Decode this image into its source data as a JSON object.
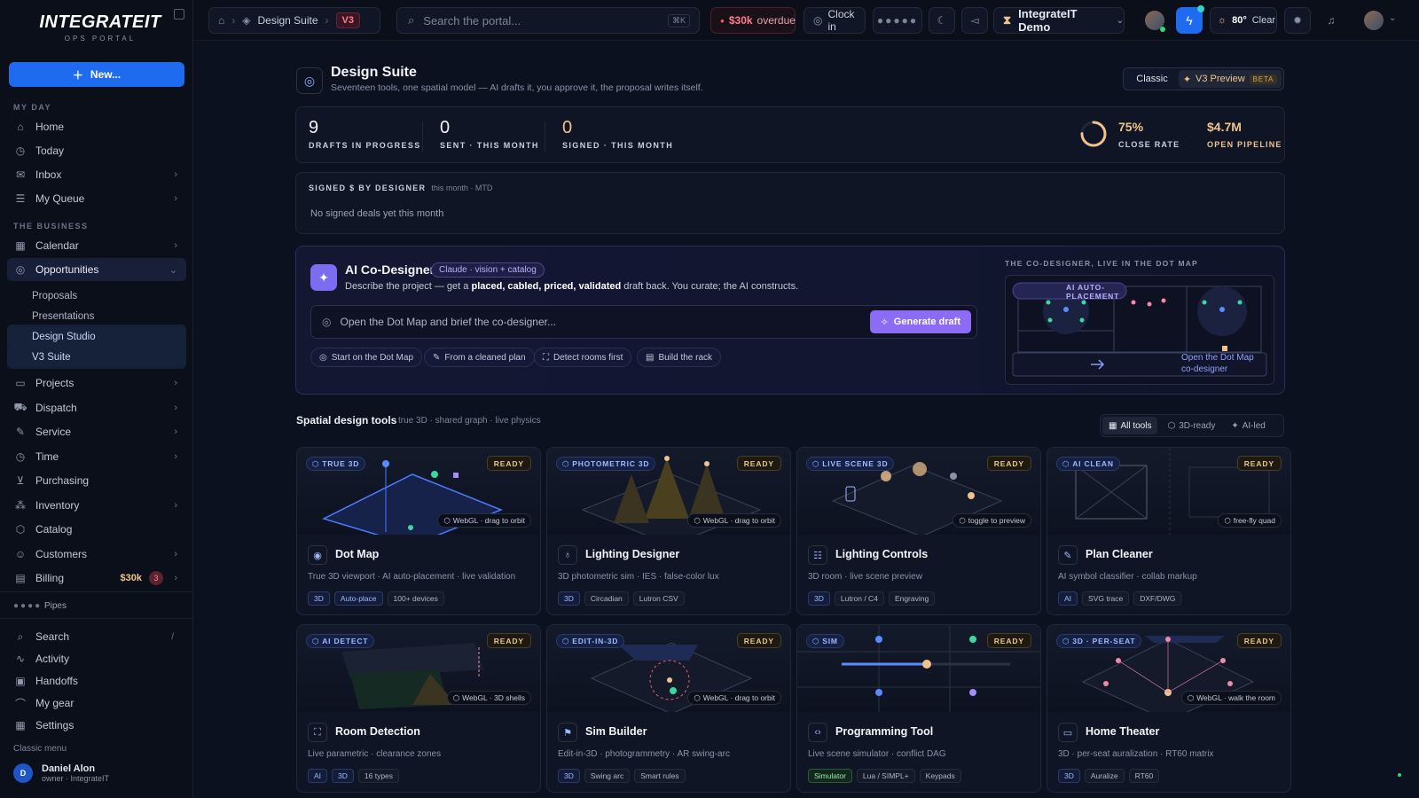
{
  "sidebar": {
    "logo": "INTEGRATEIT",
    "logo_sub": "OPS PORTAL",
    "new_button": "New...",
    "sections": {
      "my_day": "MY DAY",
      "business": "THE BUSINESS"
    },
    "my_day": [
      {
        "label": "Home",
        "icon": "home-icon"
      },
      {
        "label": "Today",
        "icon": "clock-icon"
      },
      {
        "label": "Inbox",
        "icon": "mail-icon",
        "chevron": true
      },
      {
        "label": "My Queue",
        "icon": "list-icon",
        "chevron": true
      }
    ],
    "business": [
      {
        "label": "Calendar",
        "icon": "grid-icon",
        "chevron": true
      },
      {
        "label": "Opportunities",
        "icon": "target-icon",
        "chevron": true,
        "expanded": true
      }
    ],
    "opportunities_sub": [
      "Proposals",
      "Presentations",
      "Design Studio",
      "V3 Suite"
    ],
    "business_more": [
      {
        "label": "Projects",
        "icon": "clipboard-icon",
        "chevron": true
      },
      {
        "label": "Dispatch",
        "icon": "truck-icon",
        "chevron": true
      },
      {
        "label": "Service",
        "icon": "wrench-icon",
        "chevron": true
      },
      {
        "label": "Time",
        "icon": "clock-icon",
        "chevron": true
      },
      {
        "label": "Purchasing",
        "icon": "cart-icon"
      },
      {
        "label": "Inventory",
        "icon": "boxes-icon",
        "chevron": true
      },
      {
        "label": "Catalog",
        "icon": "package-icon"
      },
      {
        "label": "Customers",
        "icon": "users-icon",
        "chevron": true
      },
      {
        "label": "Billing",
        "icon": "receipt-icon",
        "chevron": true,
        "amount": "$30k",
        "count": "3"
      }
    ],
    "pipes": "Pipes",
    "tools": [
      {
        "label": "Search",
        "icon": "search-icon",
        "shortcut": "/"
      },
      {
        "label": "Activity",
        "icon": "activity-icon"
      },
      {
        "label": "Handoffs",
        "icon": "inbox-icon"
      },
      {
        "label": "My gear",
        "icon": "gear-bag-icon"
      },
      {
        "label": "Settings",
        "icon": "grid-icon"
      }
    ],
    "classic_menu": "Classic menu",
    "user": {
      "initial": "D",
      "name": "Daniel Alon",
      "role": "owner · IntegrateIT"
    }
  },
  "topbar": {
    "breadcrumb": "Design Suite",
    "badge": "V3",
    "search_placeholder": "Search the portal...",
    "search_shortcut": "⌘K",
    "overdue_amount": "$30k",
    "overdue_label": "overdue",
    "clock_in": "Clock in",
    "org": "IntegrateIT Demo",
    "temp": "80°",
    "weather": "Clear"
  },
  "page": {
    "title": "Design Suite",
    "subtitle": "Seventeen tools, one spatial model — AI drafts it, you approve it, the proposal writes itself.",
    "toggle_classic": "Classic",
    "toggle_preview": "V3 Preview",
    "toggle_beta": "BETA"
  },
  "stats": [
    {
      "value": "9",
      "label": "DRAFTS IN PROGRESS"
    },
    {
      "value": "0",
      "label": "SENT · THIS MONTH"
    },
    {
      "value": "0",
      "label": "SIGNED · THIS MONTH"
    }
  ],
  "close_rate": {
    "value": "75%",
    "label": "CLOSE RATE",
    "fraction": 0.75
  },
  "pipeline": {
    "value": "$4.7M",
    "label": "OPEN PIPELINE"
  },
  "signed_panel": {
    "title": "SIGNED $ BY DESIGNER",
    "period": "this month · MTD",
    "empty": "No signed deals yet this month"
  },
  "ai": {
    "title": "AI Co-Designer",
    "tag": "Claude · vision + catalog",
    "desc_pre": "Describe the project — get a",
    "desc_bold": "placed, cabled, priced, validated",
    "desc_post": "draft back. You curate; the AI constructs.",
    "brief_placeholder": "Open the Dot Map and brief the co-designer...",
    "generate": "Generate draft",
    "chips": [
      "Start on the Dot Map",
      "From a cleaned plan",
      "Detect rooms first",
      "Build the rack"
    ],
    "map_label": "THE CO-DESIGNER, LIVE IN THE DOT MAP",
    "map_badge": "AI AUTO-PLACEMENT",
    "map_cta": "Open the Dot Map co-designer"
  },
  "tools_section": {
    "title": "Spatial design tools",
    "subtitle": "true 3D · shared graph · live physics",
    "filters": [
      "All tools",
      "3D-ready",
      "AI-led"
    ]
  },
  "cards": [
    {
      "badge": "TRUE 3D",
      "status": "READY",
      "overlay": "WebGL · drag to orbit",
      "name": "Dot Map",
      "icon": "pin-icon",
      "desc": "True 3D viewport · AI auto-placement · live validation",
      "tags": [
        "3D",
        "Auto-place",
        "100+ devices"
      ]
    },
    {
      "badge": "PHOTOMETRIC 3D",
      "status": "READY",
      "overlay": "WebGL · drag to orbit",
      "name": "Lighting Designer",
      "icon": "bulb-icon",
      "desc": "3D photometric sim · IES · false-color lux",
      "tags": [
        "3D",
        "Circadian",
        "Lutron CSV"
      ]
    },
    {
      "badge": "LIVE SCENE 3D",
      "status": "READY",
      "overlay": "toggle to preview",
      "name": "Lighting Controls",
      "icon": "sliders-icon",
      "desc": "3D room · live scene preview",
      "tags": [
        "3D",
        "Lutron / C4",
        "Engraving"
      ]
    },
    {
      "badge": "AI CLEAN",
      "status": "READY",
      "overlay": "free-fly quad",
      "name": "Plan Cleaner",
      "icon": "pen-icon",
      "desc": "AI symbol classifier · collab markup",
      "tags": [
        "AI",
        "SVG trace",
        "DXF/DWG"
      ]
    },
    {
      "badge": "AI DETECT",
      "status": "READY",
      "overlay": "WebGL · 3D shells",
      "name": "Room Detection",
      "icon": "scan-icon",
      "desc": "Live parametric · clearance zones",
      "tags": [
        "AI",
        "3D",
        "16 types"
      ]
    },
    {
      "badge": "EDIT-IN-3D",
      "status": "READY",
      "overlay": "WebGL · drag to orbit",
      "name": "Sim Builder",
      "icon": "flag-icon",
      "desc": "Edit-in-3D · photogrammetry · AR swing-arc",
      "tags": [
        "3D",
        "Swing arc",
        "Smart rules"
      ]
    },
    {
      "badge": "SIM",
      "status": "READY",
      "overlay": "",
      "name": "Programming Tool",
      "icon": "code-icon",
      "desc": "Live scene simulator · conflict DAG",
      "tags": [
        "Simulator",
        "Lua / SIMPL+",
        "Keypads"
      ]
    },
    {
      "badge": "3D · PER-SEAT",
      "status": "READY",
      "overlay": "WebGL · walk the room",
      "name": "Home Theater",
      "icon": "tv-icon",
      "desc": "3D · per-seat auralization · RT60 matrix",
      "tags": [
        "3D",
        "Auralize",
        "RT60"
      ]
    }
  ]
}
